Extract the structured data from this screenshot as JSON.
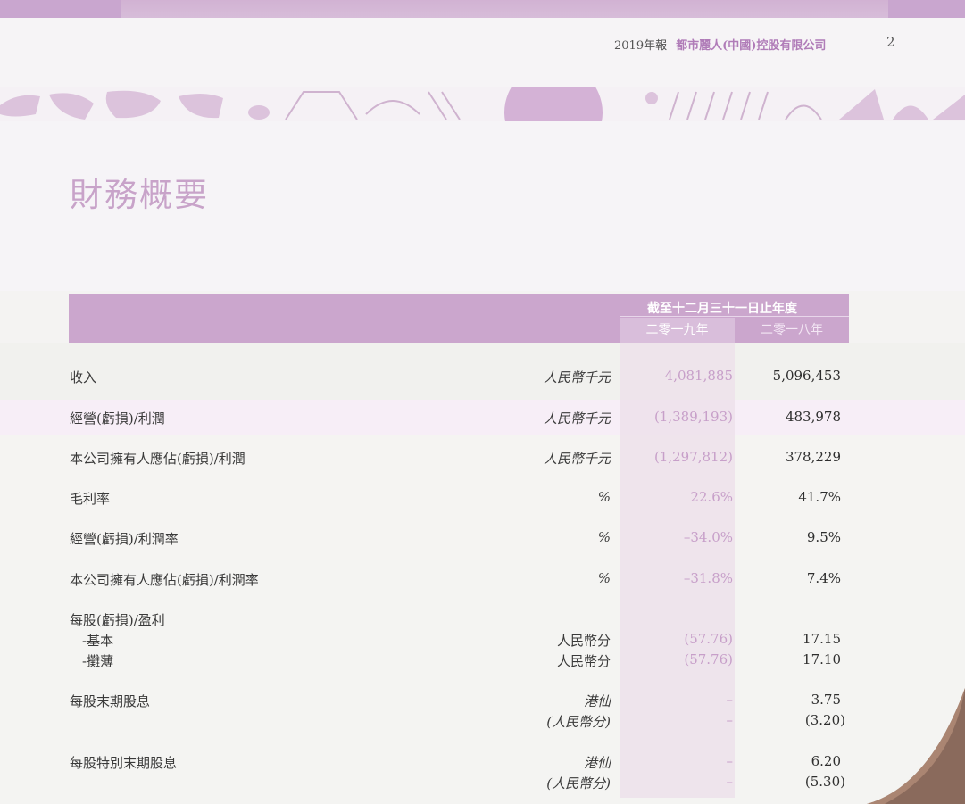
{
  "header": {
    "report_year": "2019年報",
    "company": "都市麗人(中國)控股有限公司",
    "page_number": "2"
  },
  "title": "財務概要",
  "table": {
    "period_label": "截至十二月三十一日止年度",
    "year_2019": "二零一九年",
    "year_2018": "二零一八年",
    "rows": [
      {
        "label": "收入",
        "unit": "人民幣千元",
        "v2019": "4,081,885",
        "v2018": "5,096,453"
      },
      {
        "label": "經營(虧損)/利潤",
        "unit": "人民幣千元",
        "v2019": "(1,389,193)",
        "v2018": "483,978"
      },
      {
        "label": "本公司擁有人應佔(虧損)/利潤",
        "unit": "人民幣千元",
        "v2019": "(1,297,812)",
        "v2018": "378,229"
      },
      {
        "label": "毛利率",
        "unit": "%",
        "v2019": "22.6%",
        "v2018": "41.7%"
      },
      {
        "label": "經營(虧損)/利潤率",
        "unit": "%",
        "v2019": "–34.0%",
        "v2018": "9.5%"
      },
      {
        "label": "本公司擁有人應佔(虧損)/利潤率",
        "unit": "%",
        "v2019": "–31.8%",
        "v2018": "7.4%"
      }
    ],
    "eps": {
      "label": "每股(虧損)/盈利",
      "basic": {
        "label": "-基本",
        "unit": "人民幣分",
        "v2019": "(57.76)",
        "v2018": "17.15"
      },
      "diluted": {
        "label": "-攤薄",
        "unit": "人民幣分",
        "v2019": "(57.76)",
        "v2018": "17.10"
      }
    },
    "interim_dividend": {
      "label": "每股末期股息",
      "unit1": "港仙",
      "v2019_1": "–",
      "v2018_1": "3.75",
      "unit2": "(人民幣分)",
      "v2019_2": "–",
      "v2018_2": "(3.20)"
    },
    "special_dividend": {
      "label": "每股特別末期股息",
      "unit1": "港仙",
      "v2019_1": "–",
      "v2018_1": "6.20",
      "unit2": "(人民幣分)",
      "v2019_2": "–",
      "v2018_2": "(5.30)"
    }
  },
  "colors": {
    "accent": "#cba6cd",
    "highlight": "#c79fc9"
  }
}
